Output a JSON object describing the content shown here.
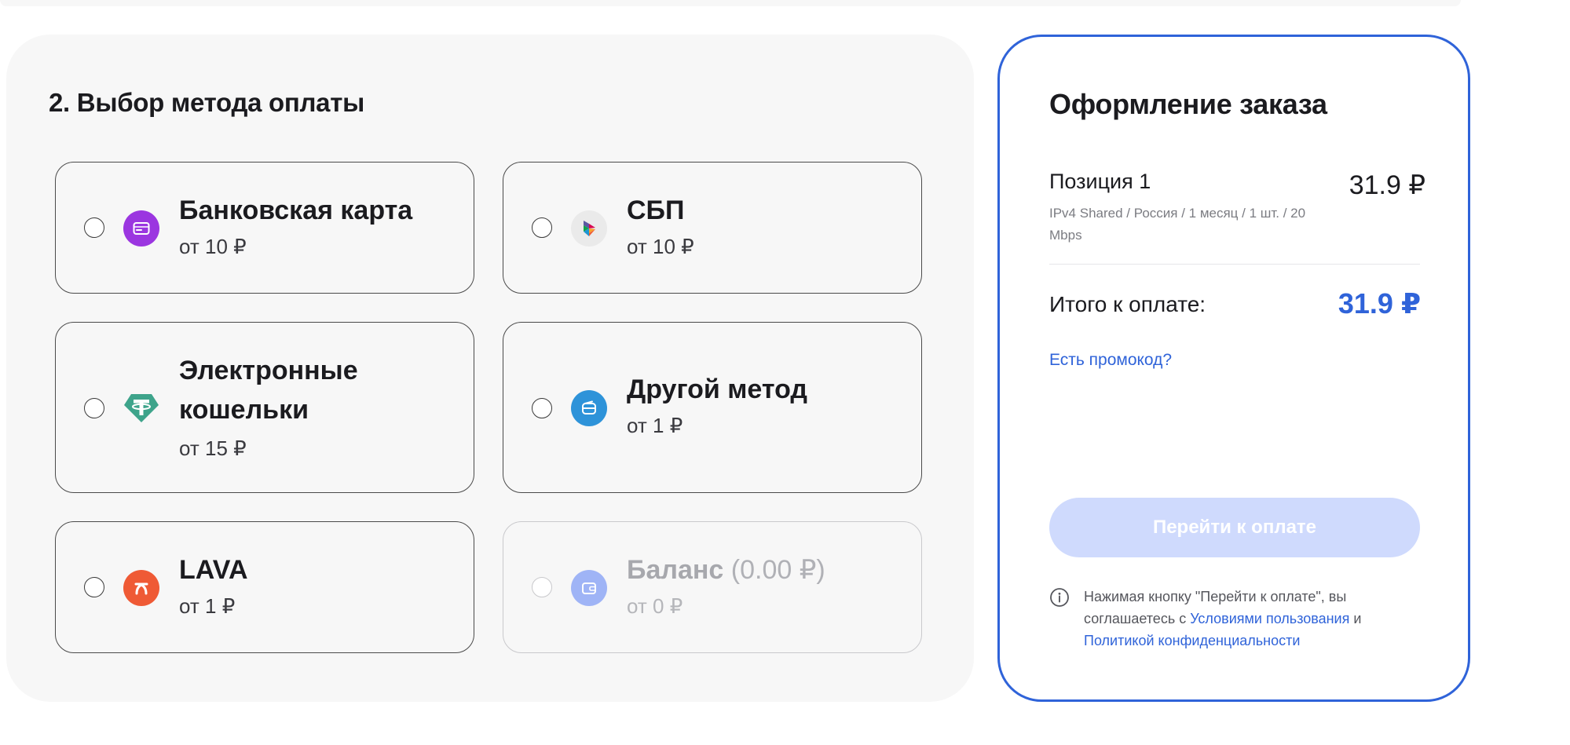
{
  "payment": {
    "title": "2. Выбор метода оплаты",
    "methods": [
      {
        "name": "Банковская карта",
        "price": "от 10 ₽",
        "icon": "bank-card-icon",
        "color": "#9b36e0"
      },
      {
        "name": "СБП",
        "price": "от 10 ₽",
        "icon": "sbp-icon",
        "color": "#eaeaea"
      },
      {
        "name_line1": "Электронные",
        "name_line2": "кошельки",
        "price": "от 15 ₽",
        "icon": "tether-icon",
        "color": "#3ea48b"
      },
      {
        "name": "Другой метод",
        "price": "от 1 ₽",
        "icon": "wallet-icon",
        "color": "#2e93d9"
      },
      {
        "name": "LAVA",
        "price": "от 1 ₽",
        "icon": "lava-icon",
        "color": "#ef5a35"
      },
      {
        "name": "Баланс",
        "amount": "(0.00 ₽)",
        "price": "от 0 ₽",
        "icon": "balance-wallet-icon",
        "color": "#9fb4f6",
        "disabled": true
      }
    ]
  },
  "order": {
    "title": "Оформление заказа",
    "position": {
      "name": "Позиция 1",
      "description": "IPv4 Shared / Россия / 1 месяц / 1 шт. / 20 Mbps",
      "price": "31.9 ₽"
    },
    "total_label": "Итого к оплате:",
    "total_value": "31.9 ₽",
    "promo_link": "Есть промокод?",
    "pay_button": "Перейти к оплате",
    "terms": {
      "prefix": "Нажимая кнопку \"Перейти к оплате\", вы соглашаетесь с ",
      "link1": "Условиями пользования",
      "middle": " и ",
      "link2": "Политикой конфиденциальности"
    }
  },
  "colors": {
    "accent": "#2f63d9",
    "button_disabled": "#cfdafd",
    "panel_bg": "#f7f7f7"
  }
}
